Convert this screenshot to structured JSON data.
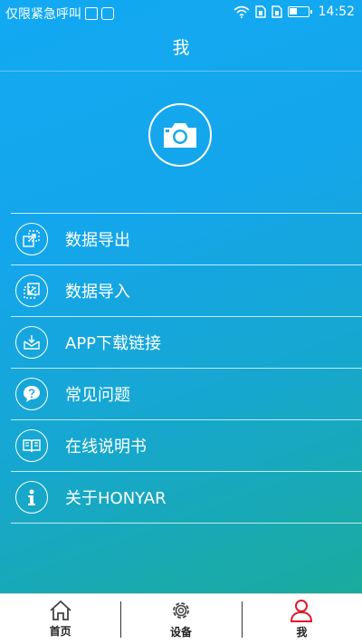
{
  "statusbar": {
    "carrier": "仅限紧急呼叫",
    "time": "14:52",
    "battery_level": 0.4
  },
  "header": {
    "title": "我"
  },
  "menu": [
    {
      "label": "数据导出",
      "icon": "export-icon"
    },
    {
      "label": "数据导入",
      "icon": "import-icon"
    },
    {
      "label": "APP下载链接",
      "icon": "download-icon"
    },
    {
      "label": "常见问题",
      "icon": "question-icon"
    },
    {
      "label": "在线说明书",
      "icon": "book-icon"
    },
    {
      "label": "关于HONYAR",
      "icon": "info-icon"
    }
  ],
  "tabs": [
    {
      "label": "首页",
      "icon": "home-icon"
    },
    {
      "label": "设备",
      "icon": "gear-icon"
    },
    {
      "label": "我",
      "icon": "user-icon",
      "active": true
    }
  ],
  "colors": {
    "background_top": "#12a9f2",
    "background_bottom": "#1bab9d",
    "active_tab": "#e0182b"
  }
}
